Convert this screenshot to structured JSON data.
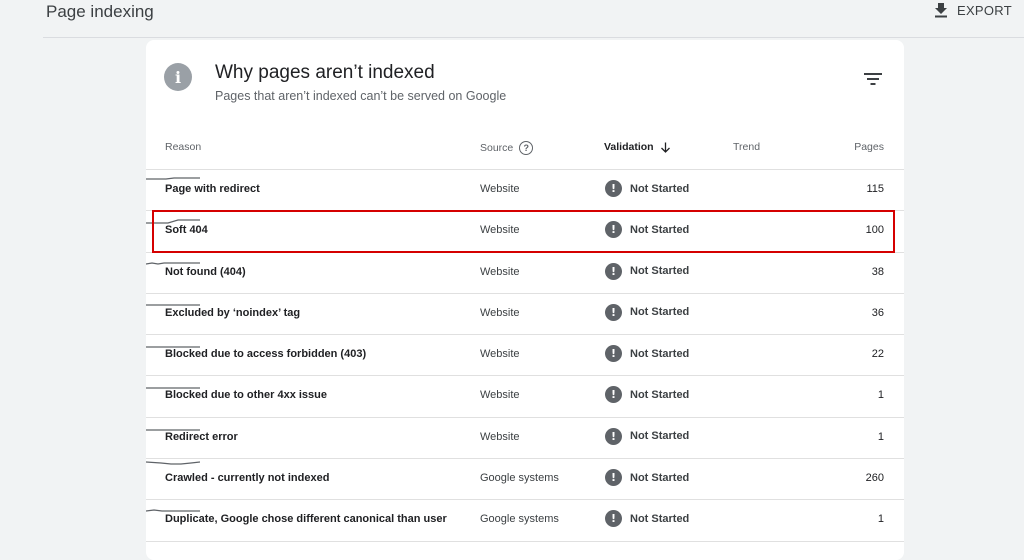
{
  "header": {
    "title": "Page indexing",
    "export_label": "EXPORT"
  },
  "card": {
    "title": "Why pages aren’t indexed",
    "subtitle": "Pages that aren’t indexed can’t be served on Google"
  },
  "table": {
    "columns": {
      "reason": "Reason",
      "source": "Source",
      "validation": "Validation",
      "trend": "Trend",
      "pages": "Pages"
    },
    "rows": [
      {
        "reason": "Page with redirect",
        "source": "Website",
        "validation": "Not Started",
        "pages": "115",
        "highlighted": false
      },
      {
        "reason": "Soft 404",
        "source": "Website",
        "validation": "Not Started",
        "pages": "100",
        "highlighted": true
      },
      {
        "reason": "Not found (404)",
        "source": "Website",
        "validation": "Not Started",
        "pages": "38",
        "highlighted": false
      },
      {
        "reason": "Excluded by ‘noindex’ tag",
        "source": "Website",
        "validation": "Not Started",
        "pages": "36",
        "highlighted": false
      },
      {
        "reason": "Blocked due to access forbidden (403)",
        "source": "Website",
        "validation": "Not Started",
        "pages": "22",
        "highlighted": false
      },
      {
        "reason": "Blocked due to other 4xx issue",
        "source": "Website",
        "validation": "Not Started",
        "pages": "1",
        "highlighted": false
      },
      {
        "reason": "Redirect error",
        "source": "Website",
        "validation": "Not Started",
        "pages": "1",
        "highlighted": false
      },
      {
        "reason": "Crawled - currently not indexed",
        "source": "Google systems",
        "validation": "Not Started",
        "pages": "260",
        "highlighted": false
      },
      {
        "reason": "Duplicate, Google chose different canonical than user",
        "source": "Google systems",
        "validation": "Not Started",
        "pages": "1",
        "highlighted": false
      }
    ]
  },
  "colors": {
    "highlight": "#d50000",
    "status_icon": "#5f6368",
    "info_icon": "#9aa0a6"
  },
  "icons": {
    "export": "download-icon",
    "info": "info-icon",
    "filter": "filter-icon",
    "help": "help-icon",
    "sort": "arrow-down-icon",
    "status": "exclamation-icon"
  }
}
